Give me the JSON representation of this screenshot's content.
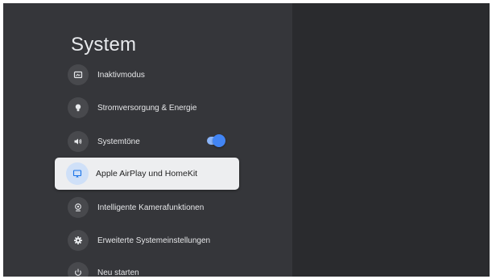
{
  "page": {
    "title": "System"
  },
  "menu": {
    "items": [
      {
        "label": "Inaktivmodus",
        "icon": "screen-icon"
      },
      {
        "label": "Stromversorgung & Energie",
        "icon": "bulb-icon"
      },
      {
        "label": "Systemtöne",
        "icon": "speaker-icon",
        "toggle": true
      },
      {
        "label": "Apple AirPlay und HomeKit",
        "icon": "airplay-icon",
        "selected": true
      },
      {
        "label": "Intelligente Kamerafunktionen",
        "icon": "webcam-icon"
      },
      {
        "label": "Erweiterte Systemeinstellungen",
        "icon": "cog-icon"
      },
      {
        "label": "Neu starten",
        "icon": "power-icon"
      }
    ]
  },
  "colors": {
    "background": "#2a2b2e",
    "panel": "#35363a",
    "selected_background": "#edeef0",
    "toggle_on": "#4285f4"
  }
}
